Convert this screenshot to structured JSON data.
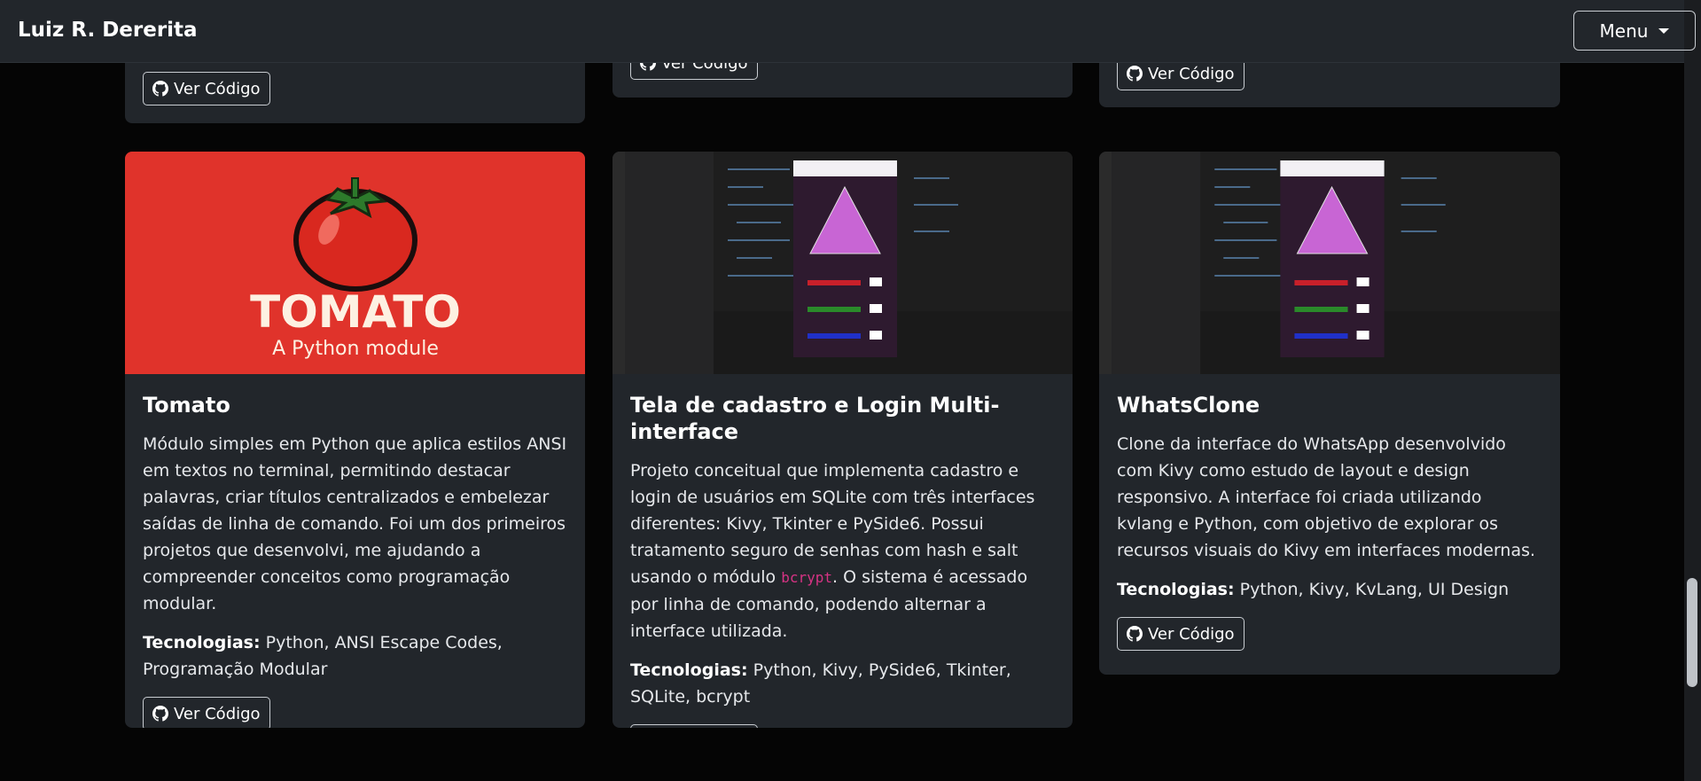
{
  "navbar": {
    "brand": "Luiz R. Dererita",
    "menu_label": "Menu"
  },
  "button_label": "Ver Código",
  "cards": [
    {
      "title": "Tomato",
      "image": {
        "word": "TOMATO",
        "subtitle": "A Python module",
        "bg": "#e0332b"
      },
      "description": "Módulo simples em Python que aplica estilos ANSI em textos no terminal, permitindo destacar palavras, criar títulos centralizados e embelezar saídas de linha de comando. Foi um dos primeiros projetos que desenvolvi, me ajudando a compreender conceitos como programação modular.",
      "tech_label": "Tecnologias:",
      "tech": "Python, ANSI Escape Codes, Programação Modular"
    },
    {
      "title": "Tela de cadastro e Login Multi-interface",
      "description_pre": "Projeto conceitual que implementa cadastro e login de usuários em SQLite com três interfaces diferentes: Kivy, Tkinter e PySide6. Possui tratamento seguro de senhas com hash e salt usando o módulo ",
      "description_code": "bcrypt",
      "description_post": ". O sistema é acessado por linha de comando, podendo alternar a interface utilizada.",
      "tech_label": "Tecnologias:",
      "tech": "Python, Kivy, PySide6, Tkinter, SQLite, bcrypt"
    },
    {
      "title": "WhatsClone",
      "description": "Clone da interface do WhatsApp desenvolvido com Kivy como estudo de layout e design responsivo. A interface foi criada utilizando kvlang e Python, com objetivo de explorar os recursos visuais do Kivy em interfaces modernas.",
      "tech_label": "Tecnologias:",
      "tech": "Python, Kivy, KvLang, UI Design"
    }
  ],
  "colors": {
    "page_bg": "#050505",
    "card_bg": "#22262b",
    "accent_code": "#d63384"
  }
}
